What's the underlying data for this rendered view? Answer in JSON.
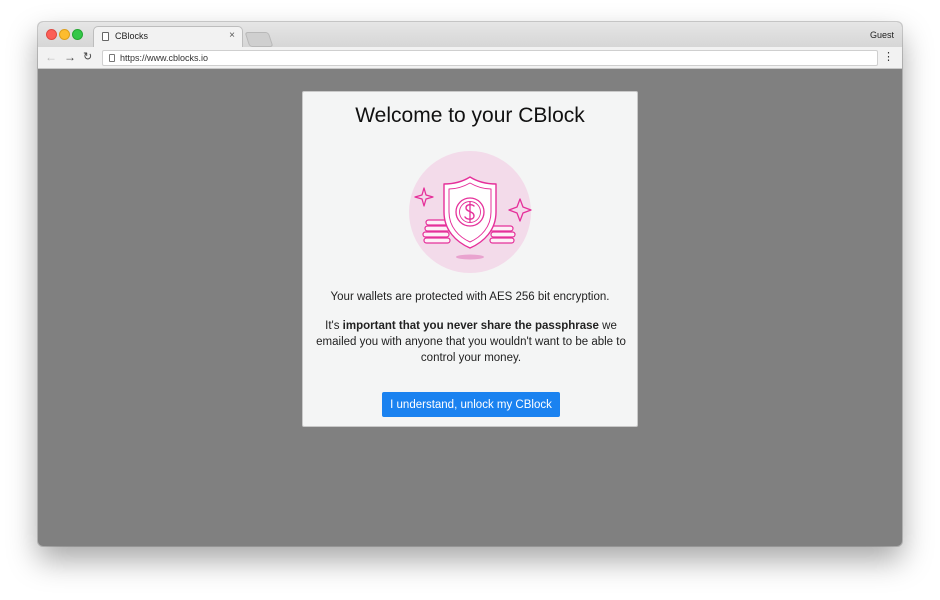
{
  "browser": {
    "tab_title": "CBlocks",
    "tab_close": "×",
    "profile": "Guest",
    "url": "https://www.cblocks.io",
    "nav": {
      "back": "←",
      "forward": "→",
      "reload": "↻",
      "menu": "⋮"
    }
  },
  "card": {
    "title": "Welcome to your CBlock",
    "illustration_icon": "shield-dollar-icon",
    "paragraph1": "Your wallets are protected with AES 256 bit encryption.",
    "paragraph2_prefix": "It's ",
    "paragraph2_bold": "important that you never share the passphrase",
    "paragraph2_suffix": " we emailed you with anyone that you wouldn't want to be able to control your money.",
    "button_label": "I understand, unlock my CBlock"
  },
  "colors": {
    "accent": "#1a82f0",
    "illustration": "#e5309a",
    "backdrop": "#808080"
  }
}
